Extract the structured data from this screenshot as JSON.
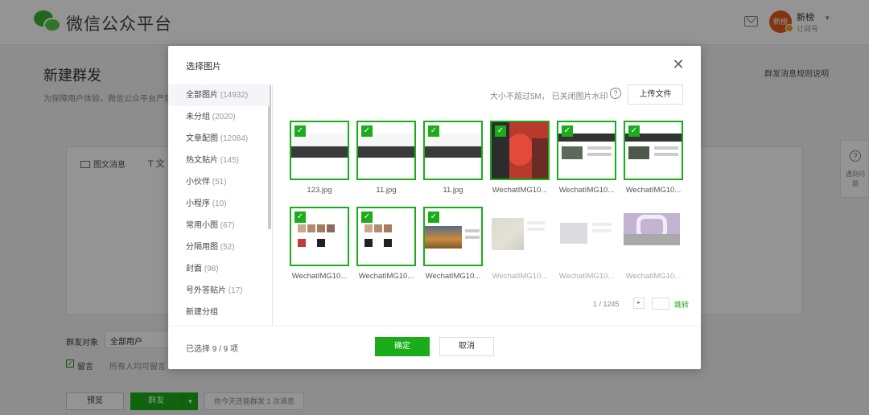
{
  "header": {
    "brand": "微信公众平台",
    "account_name": "新榜",
    "account_type": "订阅号",
    "avatar_text": "新榜"
  },
  "page": {
    "title": "新建群发",
    "subtitle": "为保障用户体验，微信公众平台严禁",
    "rule_link": "群发消息规则说明",
    "tool_news": "图文消息",
    "tool_text": "文",
    "target_label": "群发对象",
    "target_value": "全部用户",
    "comment_label": "留言",
    "comment_scope": "所有人均可留言",
    "preview_button": "预览",
    "send_button": "群发",
    "quota_text": "你今天还能群发 1 次消息"
  },
  "help_float": {
    "icon": "?",
    "label": "遇到问题"
  },
  "dialog": {
    "title": "选择图片",
    "close_icon": "close-icon",
    "size_note": "大小不超过5M，  已关闭图片水印",
    "upload_button": "上传文件",
    "categories": [
      {
        "name": "全部图片",
        "count": "(14932)"
      },
      {
        "name": "未分组",
        "count": "(2020)"
      },
      {
        "name": "文章配图",
        "count": "(12084)"
      },
      {
        "name": "热文贴片",
        "count": "(145)"
      },
      {
        "name": "小伙伴",
        "count": "(51)"
      },
      {
        "name": "小程序",
        "count": "(10)"
      },
      {
        "name": "常用小图",
        "count": "(67)"
      },
      {
        "name": "分隔用图",
        "count": "(52)"
      },
      {
        "name": "封面",
        "count": "(98)"
      },
      {
        "name": "号外答贴片",
        "count": "(17)"
      },
      {
        "name": "新建分组",
        "count": ""
      }
    ],
    "images": [
      {
        "caption": "123.jpg",
        "selected": true
      },
      {
        "caption": "11.jpg",
        "selected": true
      },
      {
        "caption": "11.jpg",
        "selected": true
      },
      {
        "caption": "WechatIMG10...",
        "selected": true
      },
      {
        "caption": "WechatIMG10...",
        "selected": true
      },
      {
        "caption": "WechatIMG10...",
        "selected": true
      },
      {
        "caption": "WechatIMG10...",
        "selected": true
      },
      {
        "caption": "WechatIMG10...",
        "selected": true
      },
      {
        "caption": "WechatIMG10...",
        "selected": true
      },
      {
        "caption": "WechatIMG10...",
        "selected": false
      },
      {
        "caption": "WechatIMG10...",
        "selected": false
      },
      {
        "caption": "WechatIMG10...",
        "selected": false
      }
    ],
    "pager": {
      "text": "1 / 1245",
      "next": "▸",
      "go": "跳转"
    },
    "selected_count": "已选择 9 / 9 项",
    "ok_button": "确定",
    "cancel_button": "取消"
  },
  "colors": {
    "accent": "#1aad19",
    "overlay": "rgba(0,0,0,0.42)"
  }
}
